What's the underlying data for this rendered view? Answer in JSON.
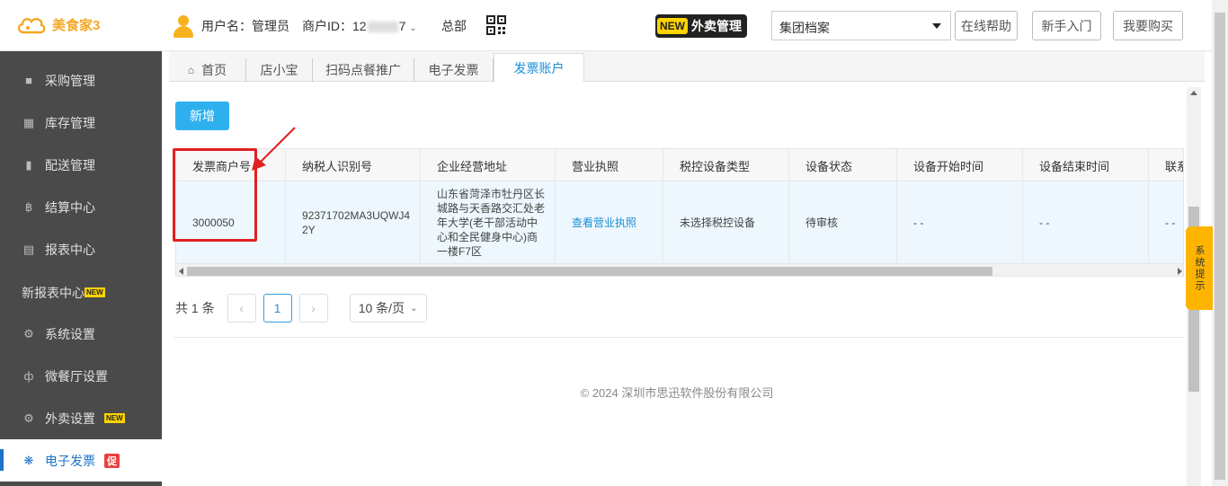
{
  "app": {
    "logo_text": "美食家3",
    "user_label": "用户名：管理员",
    "merchant_prefix": "商户ID：12",
    "merchant_suffix": "7",
    "hq": "总部",
    "takeaway_new": "NEW",
    "takeaway_label": "外卖管理",
    "archive_select": "集团档案",
    "help_btn": "在线帮助",
    "guide_btn": "新手入门",
    "buy_btn": "我要购买"
  },
  "sidebar": {
    "items": [
      {
        "label": "采购管理",
        "icon": "book-icon"
      },
      {
        "label": "库存管理",
        "icon": "inventory-icon"
      },
      {
        "label": "配送管理",
        "icon": "truck-icon"
      },
      {
        "label": "结算中心",
        "icon": "bitcoin-icon"
      },
      {
        "label": "报表中心",
        "icon": "report-icon"
      },
      {
        "label": "新报表中心",
        "badge": "NEW"
      },
      {
        "label": "系统设置",
        "icon": "gears-icon"
      },
      {
        "label": "微餐厅设置",
        "icon": "cutlery-icon"
      },
      {
        "label": "外卖设置",
        "icon": "gear-icon",
        "badge": "NEW"
      },
      {
        "label": "电子发票",
        "icon": "invoice-icon",
        "promo": "促",
        "active": true
      }
    ]
  },
  "tabs": [
    {
      "label": "首页"
    },
    {
      "label": "店小宝"
    },
    {
      "label": "扫码点餐推广"
    },
    {
      "label": "电子发票"
    },
    {
      "label": "发票账户",
      "active": true
    }
  ],
  "toolbar": {
    "add_label": "新增"
  },
  "table": {
    "headers": [
      "发票商户号",
      "纳税人识别号",
      "企业经营地址",
      "营业执照",
      "税控设备类型",
      "设备状态",
      "设备开始时间",
      "设备结束时间",
      "联系"
    ],
    "rows": [
      {
        "merchant_no": "3000050",
        "tax_id": "92371702MA3UQWJ42Y",
        "address": "山东省菏泽市牡丹区长城路与天香路交汇处老年大学(老干部活动中心和全民健身中心)商一楼F7区",
        "license": "查看营业执照",
        "device_type": "未选择税控设备",
        "status": "待审核",
        "start": "- -",
        "end": "- -",
        "contact": "- -"
      }
    ]
  },
  "pager": {
    "total": "共 1 条",
    "current": "1",
    "size": "10 条/页",
    "prev": "‹",
    "next": "›"
  },
  "footer": "© 2024 深圳市思迅软件股份有限公司",
  "side_tip": "系统提示",
  "colors": {
    "accent": "#2fb0ee",
    "sidebar_bg": "#4a4a4a",
    "highlight": "#e02020",
    "brand": "#f5a623"
  }
}
